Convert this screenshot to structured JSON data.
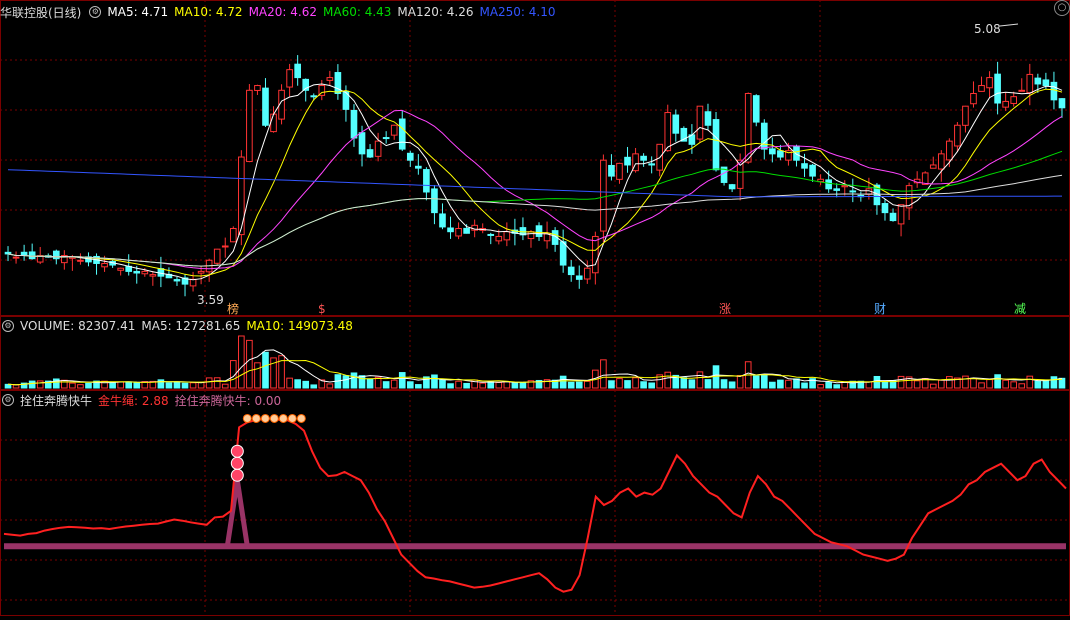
{
  "header": {
    "title": "华联控股(日线)",
    "ma": [
      {
        "label": "MA5: 4.71",
        "color": "#ffffff"
      },
      {
        "label": "MA10: 4.72",
        "color": "#ffff00"
      },
      {
        "label": "MA20: 4.62",
        "color": "#ff44ff"
      },
      {
        "label": "MA60: 4.43",
        "color": "#00dd00"
      },
      {
        "label": "MA120: 4.26",
        "color": "#dddddd"
      },
      {
        "label": "MA250: 4.10",
        "color": "#3355ff"
      }
    ]
  },
  "volume_header": [
    {
      "label": "VOLUME: 82307.41",
      "color": "#dddddd"
    },
    {
      "label": "MA5: 127281.65",
      "color": "#dddddd"
    },
    {
      "label": "MA10: 149073.48",
      "color": "#ffff00"
    }
  ],
  "indicator_header": [
    {
      "label": "拴住奔腾快牛",
      "color": "#dddddd"
    },
    {
      "label": "金牛绳: 2.88",
      "color": "#ff3333"
    },
    {
      "label": "拴住奔腾快牛: 0.00",
      "color": "#cc6699"
    }
  ],
  "colors": {
    "up": "#ff3333",
    "down": "#54ffff",
    "grid": "#7a0000",
    "indicator_line": "#ff2020",
    "indicator_base": "#993366"
  },
  "chart_data": {
    "type": "candlestick",
    "price_annotations": {
      "high": "5.08",
      "low": "3.59"
    },
    "markers": [
      "榜",
      "$",
      "涨",
      "财",
      "减"
    ],
    "closes": [
      3.79,
      3.77,
      3.78,
      3.76,
      3.78,
      3.77,
      3.76,
      3.78,
      3.77,
      3.75,
      3.74,
      3.73,
      3.73,
      3.72,
      3.7,
      3.68,
      3.67,
      3.68,
      3.66,
      3.65,
      3.64,
      3.62,
      3.6,
      3.63,
      3.68,
      3.75,
      3.82,
      3.84,
      3.95,
      4.4,
      4.82,
      4.85,
      4.6,
      4.67,
      4.82,
      4.95,
      4.9,
      4.82,
      4.78,
      4.85,
      4.9,
      4.8,
      4.7,
      4.52,
      4.42,
      4.4,
      4.5,
      4.52,
      4.6,
      4.45,
      4.38,
      4.33,
      4.18,
      4.05,
      3.96,
      3.93,
      3.95,
      3.92,
      3.97,
      3.95,
      3.91,
      3.9,
      3.93,
      3.92,
      3.91,
      3.93,
      3.9,
      3.92,
      3.85,
      3.72,
      3.66,
      3.63,
      3.7,
      3.9,
      4.38,
      4.28,
      4.36,
      4.35,
      4.42,
      4.38,
      4.35,
      4.48,
      4.68,
      4.55,
      4.5,
      4.48,
      4.72,
      4.6,
      4.32,
      4.24,
      4.2,
      4.38,
      4.8,
      4.62,
      4.45,
      4.42,
      4.4,
      4.44,
      4.38,
      4.33,
      4.28,
      4.26,
      4.2,
      4.19,
      4.22,
      4.18,
      4.15,
      4.2,
      4.1,
      4.05,
      4.0,
      4.1,
      4.22,
      4.26,
      4.3,
      4.35,
      4.42,
      4.5,
      4.6,
      4.72,
      4.8,
      4.85,
      4.9,
      4.74,
      4.75,
      4.78,
      4.82,
      4.92,
      4.86,
      4.85,
      4.76,
      4.71
    ],
    "volume_ma10": "149073.48",
    "indicator": {
      "name": "金牛绳",
      "values": [
        0.3,
        0.28,
        0.26,
        0.3,
        0.32,
        0.38,
        0.42,
        0.45,
        0.47,
        0.46,
        0.45,
        0.43,
        0.44,
        0.42,
        0.45,
        0.48,
        0.5,
        0.52,
        0.54,
        0.55,
        0.6,
        0.65,
        0.62,
        0.58,
        0.55,
        0.52,
        0.7,
        0.72,
        0.86,
        2.88,
        3.0,
        3.05,
        3.08,
        3.1,
        3.06,
        3.05,
        2.96,
        2.8,
        2.3,
        1.9,
        1.7,
        1.72,
        1.8,
        1.7,
        1.6,
        1.3,
        0.9,
        0.6,
        0.2,
        -0.2,
        -0.4,
        -0.6,
        -0.75,
        -0.78,
        -0.82,
        -0.85,
        -0.9,
        -0.95,
        -1.0,
        -0.98,
        -0.95,
        -0.9,
        -0.85,
        -0.8,
        -0.75,
        -0.7,
        -0.65,
        -0.8,
        -1.0,
        -1.1,
        -1.05,
        -0.7,
        0.2,
        1.2,
        1.0,
        1.1,
        1.3,
        1.4,
        1.2,
        1.3,
        1.25,
        1.4,
        1.8,
        2.2,
        2.0,
        1.7,
        1.5,
        1.3,
        1.2,
        1.0,
        0.8,
        0.7,
        1.3,
        1.7,
        1.5,
        1.2,
        1.1,
        0.9,
        0.7,
        0.5,
        0.3,
        0.2,
        0.1,
        0.05,
        0.0,
        -0.1,
        -0.2,
        -0.25,
        -0.3,
        -0.35,
        -0.3,
        -0.2,
        0.2,
        0.5,
        0.8,
        0.9,
        1.0,
        1.1,
        1.25,
        1.5,
        1.6,
        1.8,
        1.9,
        2.0,
        1.8,
        1.6,
        1.7,
        2.0,
        2.1,
        1.8,
        1.6,
        1.4
      ]
    },
    "indicator2_value": "0.00"
  }
}
